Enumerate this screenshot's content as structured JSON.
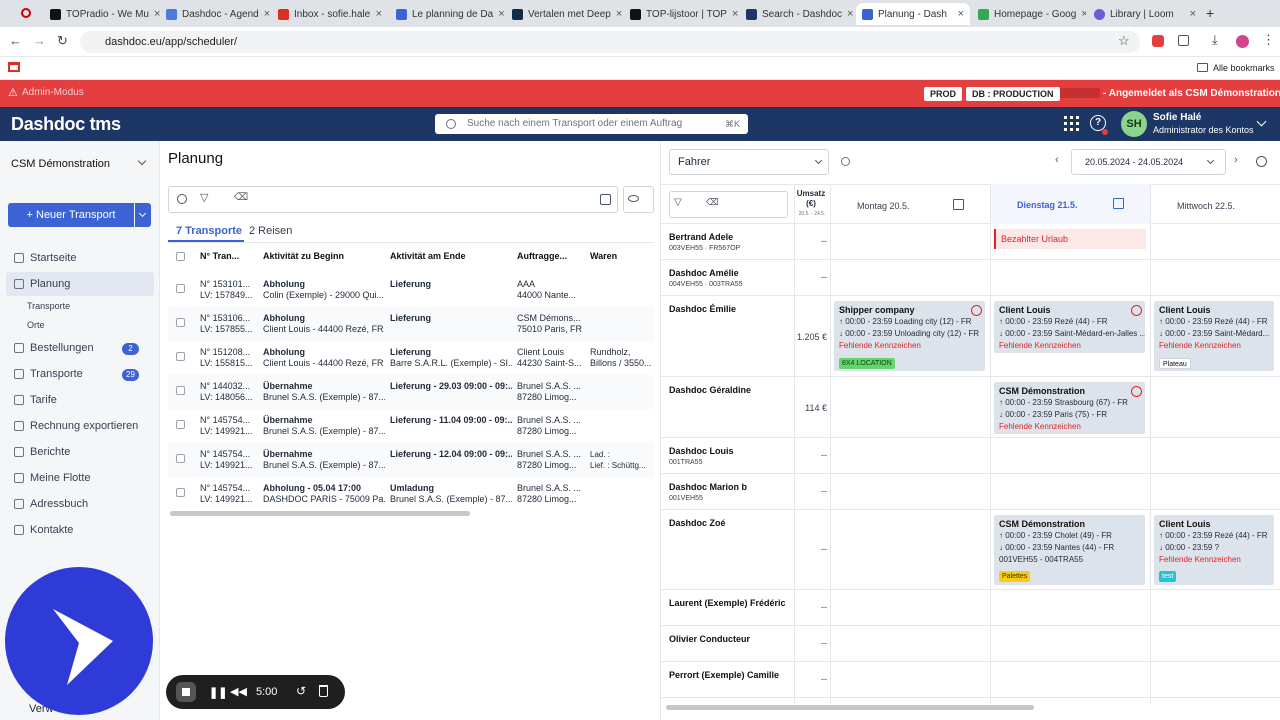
{
  "browser": {
    "tabs": [
      {
        "title": "TOPradio - We Mu"
      },
      {
        "title": "Dashdoc - Agend"
      },
      {
        "title": "Inbox - sofie.hale"
      },
      {
        "title": "Le planning de Da"
      },
      {
        "title": "Vertalen met Deep"
      },
      {
        "title": "TOP-lijstoor | TOP"
      },
      {
        "title": "Search - Dashdoc"
      },
      {
        "title": "Planung - Dash"
      },
      {
        "title": "Homepage - Goog"
      },
      {
        "title": "Library | Loom"
      }
    ],
    "url": "dashdoc.eu/app/scheduler/",
    "all_bookmarks": "Alle bookmarks"
  },
  "admin_bar": {
    "label": "Admin-Modus",
    "env": "PROD",
    "db": "DB : PRODUCTION",
    "logged_in": "- Angemeldet als CSM Démonstration",
    "color": "#e53e3e"
  },
  "header": {
    "logo": "Dashdoc tms",
    "search_placeholder": "Suche nach einem Transport oder einem Auftrag",
    "search_shortcut": "⌘K",
    "avatar_initials": "SH",
    "user_name": "Sofie Halé",
    "user_role": "Administrator des Kontos"
  },
  "sidebar": {
    "company": "CSM Démonstration",
    "new_transport": "Neuer Transport",
    "items": [
      {
        "label": "Startseite",
        "icon": "home-icon"
      },
      {
        "label": "Planung",
        "icon": "calendar-icon"
      },
      {
        "label": "Transporte",
        "icon": ""
      },
      {
        "label": "Orte",
        "icon": ""
      },
      {
        "label": "Bestellungen",
        "icon": "orders-icon",
        "badge": "2"
      },
      {
        "label": "Transporte",
        "icon": "truck-icon",
        "badge": "29"
      },
      {
        "label": "Tarife",
        "icon": "tariff-icon"
      },
      {
        "label": "Rechnung exportieren",
        "icon": "invoice-icon"
      },
      {
        "label": "Berichte",
        "icon": "report-icon"
      },
      {
        "label": "Meine Flotte",
        "icon": "fleet-icon"
      },
      {
        "label": "Adressbuch",
        "icon": "addressbook-icon"
      },
      {
        "label": "Kontakte",
        "icon": "contacts-icon"
      }
    ],
    "bottom_label": "Verw"
  },
  "planning": {
    "title": "Planung",
    "tabs": [
      "7 Transporte",
      "2 Reisen"
    ],
    "columns": [
      "N° Tran...",
      "Aktivität zu Beginn",
      "Aktivität am Ende",
      "Auftragge...",
      "Waren"
    ],
    "rows": [
      {
        "no1": "N° 153101...",
        "no2": "LV: 157849...",
        "start1": "Abholung",
        "start2": "Colin (Exemple) - 29000 Qui...",
        "end1": "Lieferung",
        "end2": "",
        "client1": "AAA",
        "client2": "44000 Nante...",
        "goods1": "",
        "goods2": ""
      },
      {
        "no1": "N° 153106...",
        "no2": "LV: 157855...",
        "start1": "Abholung",
        "start2": "Client Louis - 44400 Rezé, FR",
        "end1": "Lieferung",
        "end2": "",
        "client1": "CSM Démons...",
        "client2": "75010 Paris, FR",
        "goods1": "",
        "goods2": ""
      },
      {
        "no1": "N° 151208...",
        "no2": "LV: 155815...",
        "start1": "Abholung",
        "start2": "Client Louis - 44400 Rezé, FR",
        "end1": "Lieferung",
        "end2": "Barre S.A.R.L. (Exemple) - SI...",
        "client1": "Client Louis",
        "client2": "44230 Saint-S...",
        "goods1": "Rundholz,",
        "goods2": "Billons / 3550..."
      },
      {
        "no1": "N° 144032...",
        "no2": "LV: 148056...",
        "start1": "Übernahme",
        "start2": "Brunel S.A.S. (Exemple) - 87...",
        "end1": "Lieferung - 29.03 09:00 - 09:...",
        "end2": "",
        "client1": "Brunel S.A.S. ...",
        "client2": "87280 Limog...",
        "goods1": "",
        "goods2": ""
      },
      {
        "no1": "N° 145754...",
        "no2": "LV: 149921...",
        "start1": "Übernahme",
        "start2": "Brunel S.A.S. (Exemple) - 87...",
        "end1": "Lieferung - 11.04 09:00 - 09:...",
        "end2": "",
        "client1": "Brunel S.A.S. ...",
        "client2": "87280 Limog...",
        "goods1": "",
        "goods2": ""
      },
      {
        "no1": "N° 145754...",
        "no2": "LV: 149921...",
        "start1": "Übernahme",
        "start2": "Brunel S.A.S. (Exemple) - 87...",
        "end1": "Lieferung - 12.04 09:00 - 09:...",
        "end2": "",
        "client1": "Brunel S.A.S. ...",
        "client2": "87280 Limog...",
        "goods1": "Lad. :",
        "goods2": "Lief. : Schüttg..."
      },
      {
        "no1": "N° 145754...",
        "no2": "LV: 149921...",
        "start1": "Abholung - 05.04 17:00",
        "start2": "DASHDOC PARIS - 75009 Pa...",
        "end1": "Umladung",
        "end2": "Brunel S.A.S. (Exemple) - 87...",
        "client1": "Brunel S.A.S. ...",
        "client2": "87280 Limog...",
        "goods1": "",
        "goods2": ""
      }
    ]
  },
  "scheduler": {
    "view": "Fahrer",
    "date_range": "20.05.2024 - 24.05.2024",
    "umsatz_header": "Umsatz (€)",
    "umsatz_sub": "20.5. - 24.5.",
    "days": [
      "Montag 20.5.",
      "Dienstag 21.5.",
      "Mittwoch 22.5."
    ],
    "drivers": [
      {
        "name": "Bertrand Adele",
        "meta": "003VEH55 · FR567OP",
        "umsatz": "--"
      },
      {
        "name": "Dashdoc Amélie",
        "meta": "004VEH55 · 003TRA55",
        "umsatz": "--"
      },
      {
        "name": "Dashdoc Émilie",
        "meta": "",
        "umsatz": "1.205 €"
      },
      {
        "name": "Dashdoc Géraldine",
        "meta": "",
        "umsatz": "114 €"
      },
      {
        "name": "Dashdoc Louis",
        "meta": "001TRA55",
        "umsatz": "--"
      },
      {
        "name": "Dashdoc Marion b",
        "meta": "001VEH55",
        "umsatz": "--"
      },
      {
        "name": "Dashdoc Zoé",
        "meta": "",
        "umsatz": "--"
      },
      {
        "name": "Laurent (Exemple) Frédéric",
        "meta": "",
        "umsatz": "--"
      },
      {
        "name": "Olivier Conducteur",
        "meta": "",
        "umsatz": "--"
      },
      {
        "name": "Perrort (Exemple) Camille",
        "meta": "",
        "umsatz": "--"
      }
    ],
    "absence": "Bezahlter Urlaub",
    "cards": [
      {
        "title": "Shipper company",
        "l1": "00:00 - 23:59 Loading city (12) - FR",
        "l2": "00:00 - 23:59 Unloading city (12) - FR",
        "warn": "Fehlende Kennzeichen",
        "tag": "8X4 LOCATION"
      },
      {
        "title": "Client Louis",
        "l1": "00:00 - 23:59 Rezé (44) - FR",
        "l2": "00:00 - 23:59 Saint-Médard-en-Jalles ...",
        "warn": "Fehlende Kennzeichen",
        "tag": ""
      },
      {
        "title": "Client Louis",
        "l1": "00:00 - 23:59 Rezé (44) - FR",
        "l2": "00:00 - 23:59 Saint-Médard...",
        "warn": "Fehlende Kennzeichen",
        "tag": "Plateau"
      },
      {
        "title": "CSM Démonstration",
        "l1": "00:00 - 23:59 Strasbourg (67) - FR",
        "l2": "00:00 - 23:59 Paris (75) - FR",
        "warn": "Fehlende Kennzeichen",
        "tag": ""
      },
      {
        "title": "CSM Démonstration",
        "l1": "00:00 - 23:59 Cholet (49) - FR",
        "l2": "00:00 - 23:59 Nantes (44) - FR",
        "warn": "001VEH55 - 004TRA55",
        "tag": "Palettes"
      },
      {
        "title": "Client Louis",
        "l1": "00:00 - 23:59 Rezé (44) - FR",
        "l2": "00:00 - 23:59 ?",
        "warn": "Fehlende Kennzeichen",
        "tag": "test"
      }
    ]
  },
  "recorder": {
    "time": "5:00"
  }
}
